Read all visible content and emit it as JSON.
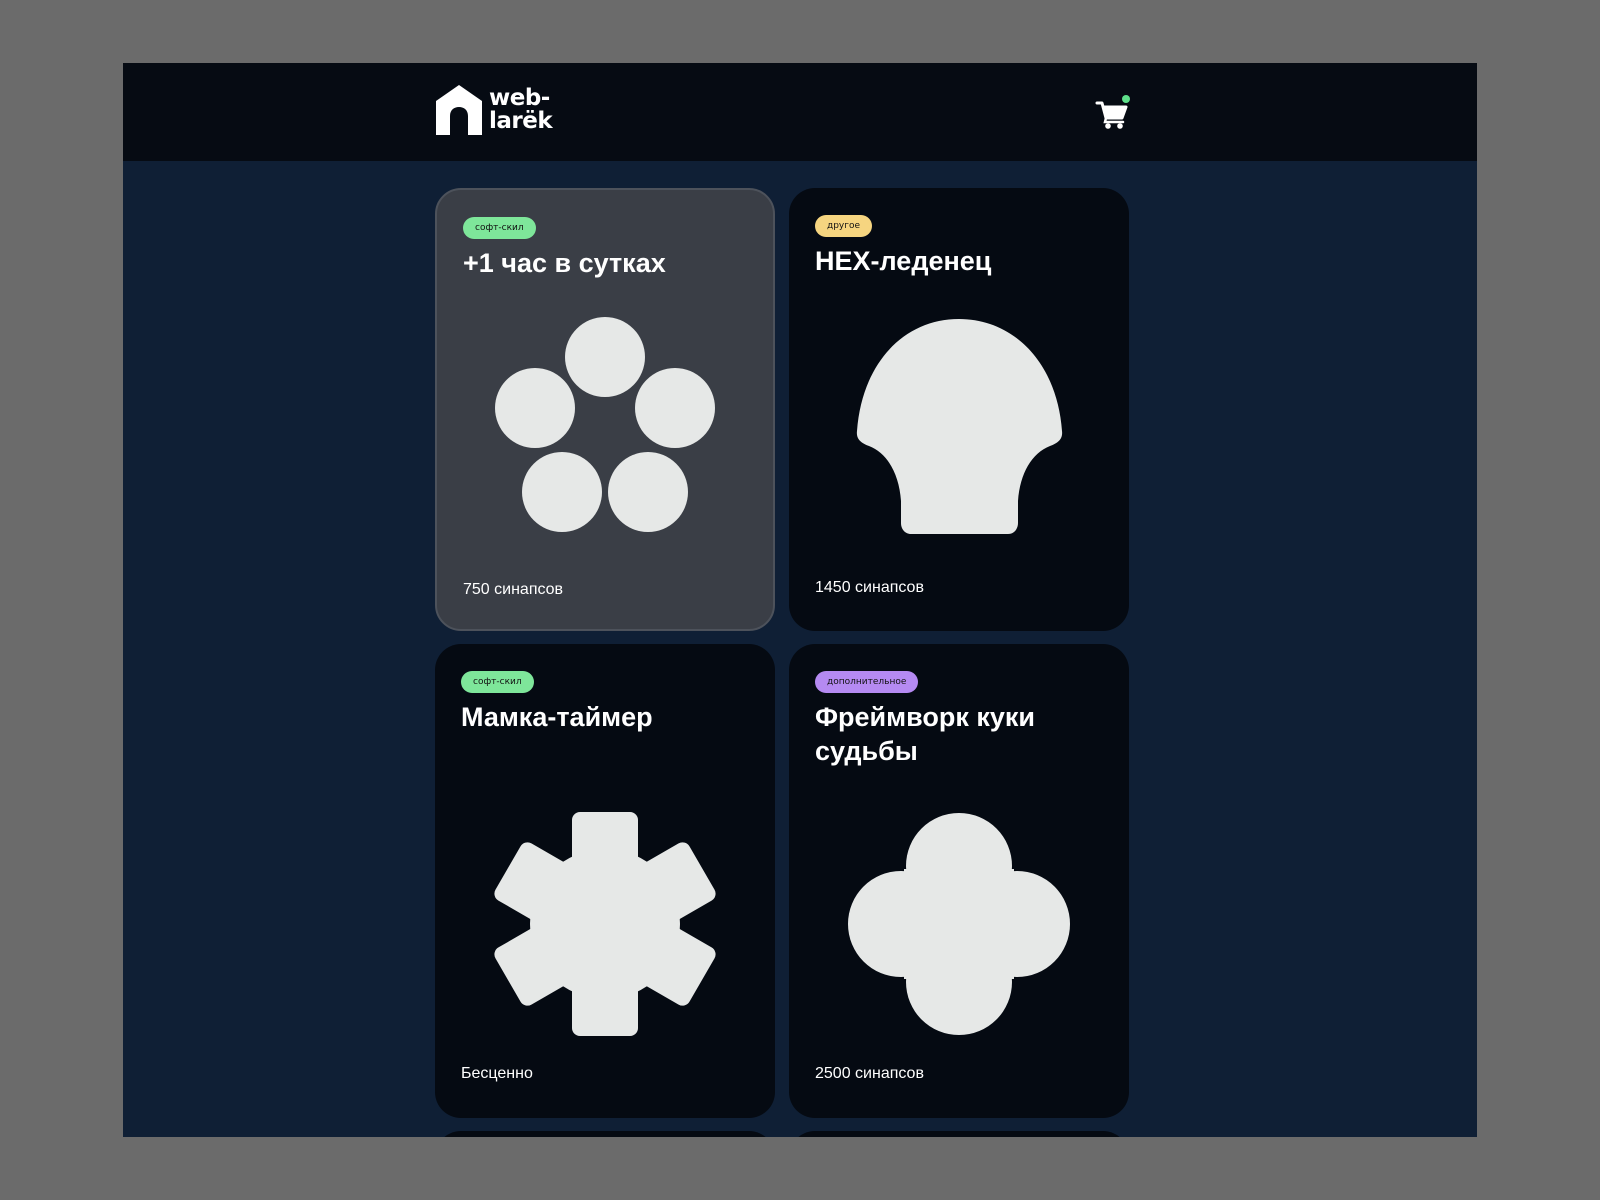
{
  "header": {
    "logo_line1": "web-",
    "logo_line2": "larёk",
    "cart_icon": "cart-icon",
    "cart_indicator_color": "#5ee08a"
  },
  "gallery": {
    "cards": [
      {
        "category": "софт-скил",
        "category_color": "#7ee69a",
        "title": "+1 час в сутках",
        "image_icon": "five-circles-icon",
        "price": "750 синапсов"
      },
      {
        "category": "другое",
        "category_color": "#f6d580",
        "title": "HEX-леденец",
        "image_icon": "shell-icon",
        "price": "1450 синапсов"
      },
      {
        "category": "софт-скил",
        "category_color": "#7ee69a",
        "title": "Мамка-таймер",
        "image_icon": "gear-icon",
        "price": "Бесценно"
      },
      {
        "category": "дополнительное",
        "category_color": "#b58af2",
        "title": "Фреймворк куки судьбы",
        "image_icon": "clover-icon",
        "price": "2500 синапсов"
      }
    ]
  }
}
